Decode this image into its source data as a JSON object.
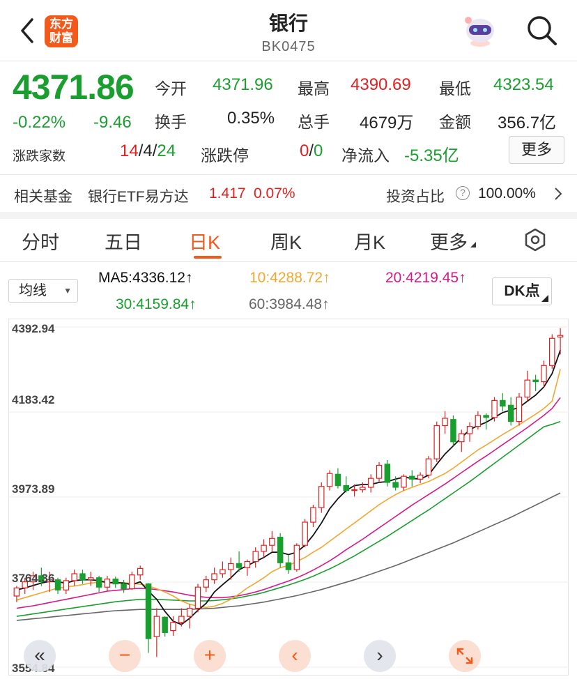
{
  "header": {
    "logo_line1": "东方",
    "logo_line2": "财富",
    "title": "银行",
    "code": "BK0475"
  },
  "quote": {
    "price": "4371.86",
    "change_pct": "-0.22%",
    "change": "-9.46",
    "open_label": "今开",
    "open": "4371.96",
    "high_label": "最高",
    "high": "4390.69",
    "low_label": "最低",
    "low": "4323.54",
    "turnover_label": "换手",
    "turnover": "0.35%",
    "volume_label": "总手",
    "volume": "4679万",
    "amount_label": "金额",
    "amount": "356.7亿",
    "breadth_label": "涨跌家数",
    "up": "14",
    "flat": "4",
    "down": "24",
    "limit_label": "涨跌停",
    "limit_up": "0",
    "limit_down": "0",
    "inflow_label": "净流入",
    "inflow": "-5.35亿",
    "more_label": "更多"
  },
  "fund": {
    "label": "相关基金",
    "name": "银行ETF易方达",
    "price": "1.417",
    "pct": "0.07%",
    "ratio_label": "投资占比",
    "ratio": "100.00%"
  },
  "tabs": [
    "分时",
    "五日",
    "日K",
    "周K",
    "月K",
    "更多"
  ],
  "active_tab": "日K",
  "ma": {
    "selector": "均线",
    "ma5": "MA5:4336.12",
    "ma10": "10:4288.72",
    "ma20": "20:4219.45",
    "ma30": "30:4159.84",
    "ma60": "60:3984.48",
    "dk_label": "DK点",
    "colors": {
      "ma5": "#111111",
      "ma10": "#f0a830",
      "ma20": "#d6198a",
      "ma30": "#1a9e2f",
      "ma60": "#666666"
    }
  },
  "colors": {
    "up": "#e02020",
    "down": "#1a9e2f",
    "accent": "#f25a1c"
  },
  "chart_data": {
    "type": "candlestick",
    "y_ticks": [
      "4392.94",
      "4183.42",
      "3973.89",
      "3764.36",
      "3554.84"
    ],
    "ylim": [
      3554.84,
      4392.94
    ],
    "candles": [
      [
        3730,
        3755,
        3715,
        3750
      ],
      [
        3750,
        3775,
        3735,
        3765
      ],
      [
        3765,
        3790,
        3745,
        3780
      ],
      [
        3780,
        3800,
        3755,
        3765
      ],
      [
        3765,
        3790,
        3740,
        3770
      ],
      [
        3770,
        3775,
        3735,
        3745
      ],
      [
        3745,
        3775,
        3735,
        3768
      ],
      [
        3768,
        3795,
        3755,
        3785
      ],
      [
        3785,
        3795,
        3760,
        3770
      ],
      [
        3770,
        3790,
        3755,
        3775
      ],
      [
        3775,
        3780,
        3740,
        3752
      ],
      [
        3752,
        3780,
        3742,
        3772
      ],
      [
        3772,
        3778,
        3750,
        3760
      ],
      [
        3760,
        3770,
        3738,
        3748
      ],
      [
        3748,
        3790,
        3745,
        3782
      ],
      [
        3782,
        3805,
        3770,
        3798
      ],
      [
        3760,
        3762,
        3590,
        3625
      ],
      [
        3630,
        3700,
        3580,
        3680
      ],
      [
        3678,
        3680,
        3630,
        3640
      ],
      [
        3645,
        3680,
        3632,
        3665
      ],
      [
        3665,
        3700,
        3655,
        3680
      ],
      [
        3680,
        3710,
        3650,
        3700
      ],
      [
        3700,
        3760,
        3690,
        3752
      ],
      [
        3752,
        3780,
        3740,
        3770
      ],
      [
        3770,
        3800,
        3760,
        3785
      ],
      [
        3785,
        3815,
        3775,
        3795
      ],
      [
        3795,
        3825,
        3770,
        3810
      ],
      [
        3810,
        3840,
        3790,
        3800
      ],
      [
        3800,
        3820,
        3780,
        3815
      ],
      [
        3815,
        3850,
        3800,
        3840
      ],
      [
        3840,
        3870,
        3825,
        3855
      ],
      [
        3855,
        3890,
        3840,
        3872
      ],
      [
        3875,
        3885,
        3800,
        3812
      ],
      [
        3812,
        3830,
        3785,
        3795
      ],
      [
        3795,
        3860,
        3790,
        3855
      ],
      [
        3855,
        3920,
        3850,
        3912
      ],
      [
        3912,
        3955,
        3900,
        3948
      ],
      [
        3948,
        4010,
        3935,
        4000
      ],
      [
        4000,
        4040,
        3990,
        4032
      ],
      [
        4030,
        4045,
        3995,
        4002
      ],
      [
        4002,
        4025,
        3985,
        3990
      ],
      [
        3990,
        4005,
        3975,
        3992
      ],
      [
        3992,
        4010,
        3985,
        3998
      ],
      [
        3998,
        4030,
        3985,
        4020
      ],
      [
        4020,
        4060,
        4010,
        4052
      ],
      [
        4055,
        4065,
        4000,
        4010
      ],
      [
        4010,
        4025,
        3990,
        3998
      ],
      [
        3998,
        4030,
        3990,
        4025
      ],
      [
        4025,
        4040,
        4000,
        4018
      ],
      [
        4018,
        4035,
        4008,
        4028
      ],
      [
        4028,
        4075,
        4020,
        4068
      ],
      [
        4068,
        4160,
        4060,
        4150
      ],
      [
        4150,
        4185,
        4130,
        4168
      ],
      [
        4165,
        4175,
        4100,
        4110
      ],
      [
        4110,
        4140,
        4085,
        4130
      ],
      [
        4130,
        4158,
        4110,
        4148
      ],
      [
        4148,
        4185,
        4140,
        4175
      ],
      [
        4175,
        4180,
        4140,
        4170
      ],
      [
        4170,
        4220,
        4160,
        4212
      ],
      [
        4212,
        4230,
        4185,
        4198
      ],
      [
        4200,
        4220,
        4150,
        4160
      ],
      [
        4160,
        4230,
        4150,
        4220
      ],
      [
        4220,
        4285,
        4210,
        4262
      ],
      [
        4262,
        4275,
        4235,
        4258
      ],
      [
        4258,
        4310,
        4245,
        4298
      ],
      [
        4298,
        4375,
        4290,
        4365
      ],
      [
        4368,
        4390,
        4325,
        4372
      ]
    ],
    "ma5": [
      3745,
      3750,
      3756,
      3762,
      3766,
      3765,
      3762,
      3768,
      3770,
      3770,
      3768,
      3763,
      3763,
      3762,
      3758,
      3765,
      3742,
      3722,
      3692,
      3668,
      3660,
      3675,
      3695,
      3712,
      3740,
      3758,
      3775,
      3795,
      3805,
      3815,
      3825,
      3838,
      3838,
      3832,
      3838,
      3855,
      3880,
      3910,
      3945,
      3970,
      3990,
      4002,
      4005,
      4005,
      4010,
      4012,
      4018,
      4023,
      4020,
      4018,
      4028,
      4055,
      4080,
      4100,
      4120,
      4140,
      4150,
      4158,
      4170,
      4182,
      4188,
      4195,
      4210,
      4225,
      4245,
      4278,
      4336
    ],
    "ma10": [
      3720,
      3726,
      3732,
      3738,
      3744,
      3750,
      3752,
      3755,
      3758,
      3762,
      3764,
      3764,
      3764,
      3763,
      3761,
      3759,
      3755,
      3748,
      3740,
      3730,
      3718,
      3710,
      3705,
      3702,
      3705,
      3712,
      3722,
      3735,
      3750,
      3762,
      3775,
      3790,
      3800,
      3805,
      3815,
      3825,
      3838,
      3850,
      3865,
      3880,
      3895,
      3910,
      3925,
      3940,
      3955,
      3968,
      3980,
      3990,
      3998,
      4005,
      4012,
      4022,
      4032,
      4045,
      4060,
      4075,
      4090,
      4102,
      4115,
      4128,
      4140,
      4152,
      4165,
      4178,
      4192,
      4210,
      4289
    ],
    "ma20": [
      3700,
      3703,
      3706,
      3710,
      3714,
      3718,
      3722,
      3726,
      3730,
      3734,
      3738,
      3742,
      3744,
      3746,
      3748,
      3749,
      3748,
      3746,
      3743,
      3740,
      3736,
      3732,
      3729,
      3727,
      3726,
      3726,
      3728,
      3731,
      3735,
      3740,
      3746,
      3753,
      3760,
      3767,
      3775,
      3784,
      3794,
      3805,
      3817,
      3830,
      3844,
      3857,
      3870,
      3884,
      3898,
      3912,
      3926,
      3940,
      3954,
      3967,
      3980,
      3993,
      4006,
      4020,
      4034,
      4048,
      4062,
      4075,
      4089,
      4103,
      4117,
      4131,
      4145,
      4160,
      4175,
      4192,
      4219
    ],
    "ma30": [
      3680,
      3683,
      3686,
      3689,
      3692,
      3695,
      3698,
      3701,
      3704,
      3707,
      3710,
      3713,
      3716,
      3718,
      3720,
      3722,
      3722,
      3722,
      3721,
      3720,
      3719,
      3718,
      3718,
      3718,
      3719,
      3721,
      3723,
      3726,
      3730,
      3734,
      3739,
      3745,
      3751,
      3757,
      3764,
      3771,
      3779,
      3788,
      3797,
      3807,
      3818,
      3829,
      3841,
      3853,
      3865,
      3877,
      3890,
      3903,
      3916,
      3929,
      3942,
      3956,
      3970,
      3984,
      3998,
      4012,
      4027,
      4042,
      4057,
      4072,
      4087,
      4102,
      4117,
      4132,
      4147,
      4153,
      4160
    ],
    "ma60": [
      3670,
      3672,
      3674,
      3676,
      3678,
      3680,
      3682,
      3684,
      3686,
      3688,
      3690,
      3692,
      3694,
      3695,
      3696,
      3697,
      3697,
      3697,
      3697,
      3697,
      3697,
      3697,
      3698,
      3699,
      3700,
      3702,
      3704,
      3706,
      3709,
      3712,
      3715,
      3719,
      3723,
      3727,
      3731,
      3736,
      3741,
      3746,
      3752,
      3758,
      3764,
      3770,
      3777,
      3784,
      3791,
      3798,
      3805,
      3813,
      3821,
      3829,
      3837,
      3845,
      3853,
      3861,
      3870,
      3879,
      3888,
      3897,
      3906,
      3915,
      3924,
      3934,
      3944,
      3954,
      3964,
      3974,
      3984
    ]
  }
}
